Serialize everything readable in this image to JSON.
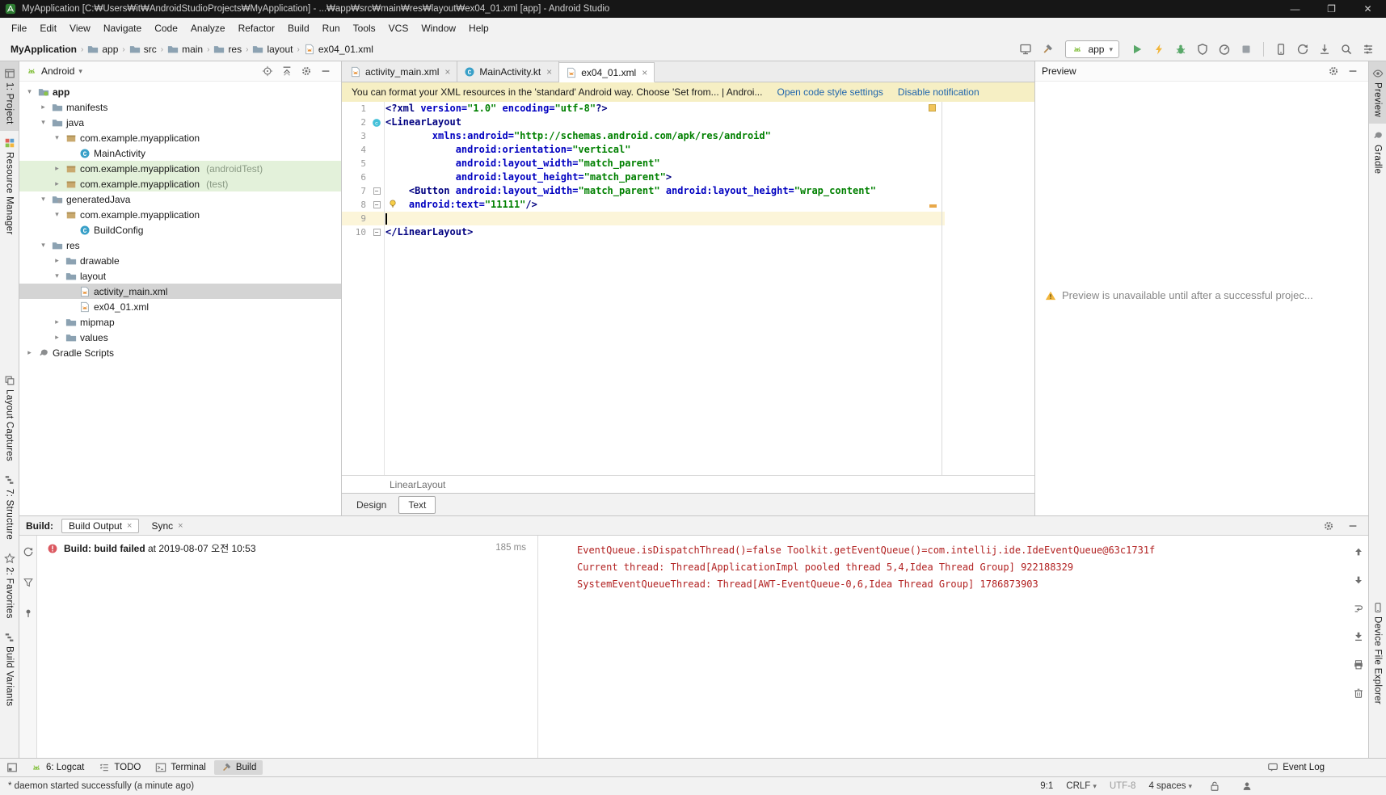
{
  "colors": {
    "accent_link": "#2166AC",
    "error_text": "#B22222",
    "banner_bg": "#F6EFC4",
    "selection_gray": "#D4D4D4",
    "test_scope_green": "#E3F1DA",
    "current_line": "#FCF5D9",
    "run_green": "#59A869",
    "tag_navy": "#000080",
    "value_green": "#008000"
  },
  "titlebar": {
    "title": "MyApplication [C:₩Users₩it₩AndroidStudioProjects₩MyApplication] - ...₩app₩src₩main₩res₩layout₩ex04_01.xml [app] - Android Studio",
    "controls": {
      "minimize": "—",
      "maximize": "❐",
      "close": "✕"
    }
  },
  "menubar": {
    "items": [
      "File",
      "Edit",
      "View",
      "Navigate",
      "Code",
      "Analyze",
      "Refactor",
      "Build",
      "Run",
      "Tools",
      "VCS",
      "Window",
      "Help"
    ]
  },
  "toolbar": {
    "breadcrumbs": [
      {
        "label": "MyApplication",
        "icon": null,
        "bold": true
      },
      {
        "label": "app",
        "icon": "folder-icon"
      },
      {
        "label": "src",
        "icon": "folder-icon"
      },
      {
        "label": "main",
        "icon": "folder-icon"
      },
      {
        "label": "res",
        "icon": "folder-icon"
      },
      {
        "label": "layout",
        "icon": "folder-icon"
      },
      {
        "label": "ex04_01.xml",
        "icon": "xml-file-icon"
      }
    ],
    "left_icons": [
      "layout-inspector-icon",
      "build-hammer-icon"
    ],
    "run_config": {
      "label": "app",
      "icon": "android-head-icon"
    },
    "right_icons": [
      "run-icon",
      "apply-changes-icon",
      "debug-icon",
      "coverage-icon",
      "profiler-icon",
      "stop-icon"
    ],
    "far_icons": [
      "avd-manager-icon",
      "gradle-sync-icon",
      "sdk-manager-icon",
      "search-icon",
      "project-structure-icon"
    ]
  },
  "project_panel": {
    "header": {
      "view": "Android",
      "icons": [
        "target-icon",
        "collapse-all-icon",
        "gear-icon",
        "hide-icon"
      ]
    },
    "tree": [
      {
        "label": "app",
        "icon": "android-module-icon",
        "chev": "down",
        "indent": 0,
        "bold": true
      },
      {
        "label": "manifests",
        "icon": "folder-icon",
        "chev": "right",
        "indent": 1
      },
      {
        "label": "java",
        "icon": "folder-icon",
        "chev": "down",
        "indent": 1
      },
      {
        "label": "com.example.myapplication",
        "icon": "package-icon",
        "chev": "down",
        "indent": 2
      },
      {
        "label": "MainActivity",
        "icon": "class-icon",
        "indent": 3
      },
      {
        "label": "com.example.myapplication",
        "suffix": "(androidTest)",
        "icon": "package-icon",
        "chev": "right",
        "indent": 2,
        "highlight": "green"
      },
      {
        "label": "com.example.myapplication",
        "suffix": "(test)",
        "icon": "package-icon",
        "chev": "right",
        "indent": 2,
        "highlight": "green"
      },
      {
        "label": "generatedJava",
        "icon": "generated-folder-icon",
        "chev": "down",
        "indent": 1
      },
      {
        "label": "com.example.myapplication",
        "icon": "package-icon",
        "chev": "down",
        "indent": 2
      },
      {
        "label": "BuildConfig",
        "icon": "class-icon",
        "indent": 3
      },
      {
        "label": "res",
        "icon": "folder-icon",
        "chev": "down",
        "indent": 1
      },
      {
        "label": "drawable",
        "icon": "folder-icon",
        "chev": "right",
        "indent": 2
      },
      {
        "label": "layout",
        "icon": "folder-icon",
        "chev": "down",
        "indent": 2
      },
      {
        "label": "activity_main.xml",
        "icon": "xml-file-icon",
        "indent": 3,
        "selected": true
      },
      {
        "label": "ex04_01.xml",
        "icon": "xml-file-icon",
        "indent": 3
      },
      {
        "label": "mipmap",
        "icon": "folder-icon",
        "chev": "right",
        "indent": 2
      },
      {
        "label": "values",
        "icon": "folder-icon",
        "chev": "right",
        "indent": 2
      },
      {
        "label": "Gradle Scripts",
        "icon": "gradle-icon",
        "chev": "right",
        "indent": 0
      }
    ]
  },
  "editor": {
    "tabs": [
      {
        "label": "activity_main.xml",
        "icon": "xml-file-icon",
        "active": false
      },
      {
        "label": "MainActivity.kt",
        "icon": "kotlin-class-icon",
        "active": false
      },
      {
        "label": "ex04_01.xml",
        "icon": "xml-file-icon",
        "active": true
      }
    ],
    "notification": {
      "text": "You can format your XML resources in the 'standard' Android way. Choose 'Set from... | Androi...",
      "link_primary": "Open code style settings",
      "link_secondary": "Disable notification"
    },
    "code": {
      "lines": [
        {
          "num": 1,
          "tokens": [
            [
              "tag",
              "<?xml"
            ],
            [
              "plain",
              " "
            ],
            [
              "attr",
              "version="
            ],
            [
              "val",
              "\"1.0\""
            ],
            [
              "plain",
              " "
            ],
            [
              "attr",
              "encoding="
            ],
            [
              "val",
              "\"utf-8\""
            ],
            [
              "tag",
              "?>"
            ]
          ]
        },
        {
          "num": 2,
          "gutter_icon": "class-circle-icon",
          "tokens": [
            [
              "tag",
              "<LinearLayout"
            ]
          ]
        },
        {
          "num": 3,
          "tokens": [
            [
              "plain",
              "        "
            ],
            [
              "attr",
              "xmlns:android="
            ],
            [
              "val",
              "\"http://schemas.android.com/apk/res/android\""
            ]
          ]
        },
        {
          "num": 4,
          "tokens": [
            [
              "plain",
              "            "
            ],
            [
              "attr",
              "android:orientation="
            ],
            [
              "val",
              "\"vertical\""
            ]
          ]
        },
        {
          "num": 5,
          "tokens": [
            [
              "plain",
              "            "
            ],
            [
              "attr",
              "android:layout_width="
            ],
            [
              "val",
              "\"match_parent\""
            ]
          ]
        },
        {
          "num": 6,
          "tokens": [
            [
              "plain",
              "            "
            ],
            [
              "attr",
              "android:layout_height="
            ],
            [
              "val",
              "\"match_parent\""
            ],
            [
              "tag",
              ">"
            ]
          ]
        },
        {
          "num": 7,
          "fold": "minus",
          "tokens": [
            [
              "plain",
              "    "
            ],
            [
              "tag",
              "<Button"
            ],
            [
              "plain",
              " "
            ],
            [
              "attr",
              "android:layout_width="
            ],
            [
              "val",
              "\"match_parent\""
            ],
            [
              "plain",
              " "
            ],
            [
              "attr",
              "android:layout_height="
            ],
            [
              "val",
              "\"wrap_content\""
            ]
          ]
        },
        {
          "num": 8,
          "fold": "minus",
          "bulb": true,
          "tokens": [
            [
              "plain",
              "    "
            ],
            [
              "attr",
              "android:text="
            ],
            [
              "val",
              "\"11111\""
            ],
            [
              "tag",
              "/>"
            ]
          ]
        },
        {
          "num": 9,
          "current": true,
          "cursor": true,
          "tokens": []
        },
        {
          "num": 10,
          "fold": "end",
          "tokens": [
            [
              "tag",
              "</LinearLayout>"
            ]
          ]
        }
      ]
    },
    "breadcrumb": "LinearLayout",
    "mode_tabs": [
      {
        "label": "Design",
        "active": false
      },
      {
        "label": "Text",
        "active": true
      }
    ]
  },
  "preview_panel": {
    "title": "Preview",
    "icons": [
      "gear-icon",
      "hide-icon"
    ],
    "message": "Preview is unavailable until after a successful projec..."
  },
  "build_panel": {
    "label": "Build:",
    "tabs": [
      {
        "label": "Build Output",
        "active": true
      },
      {
        "label": "Sync",
        "active": false
      }
    ],
    "header_icons": [
      "gear-icon",
      "hide-icon"
    ],
    "side_icons": [
      "rerun-icon",
      "filter-icon",
      "pin-icon"
    ],
    "status": {
      "bold": "Build: build failed",
      "rest": " at 2019-08-07 오전 10:53",
      "duration": "185 ms"
    },
    "console": [
      "EventQueue.isDispatchThread()=false Toolkit.getEventQueue()=com.intellij.ide.IdeEventQueue@63c1731f",
      "Current thread: Thread[ApplicationImpl pooled thread 5,4,Idea Thread Group] 922188329",
      "SystemEventQueueThread: Thread[AWT-EventQueue-0,6,Idea Thread Group] 1786873903"
    ],
    "console_icons": [
      "up-icon",
      "down-icon",
      "soft-wrap-icon",
      "scroll-end-icon",
      "print-icon",
      "clear-icon"
    ]
  },
  "tool_stripes": {
    "left_top": [
      {
        "label": "1: Project",
        "icon": "project-icon",
        "active": true
      },
      {
        "label": "Resource Manager",
        "icon": "resource-manager-icon"
      }
    ],
    "left_bottom": [
      {
        "label": "Layout Captures",
        "icon": "layout-captures-icon"
      },
      {
        "label": "7: Structure",
        "icon": "structure-icon"
      },
      {
        "label": "2: Favorites",
        "icon": "favorites-icon"
      },
      {
        "label": "Build Variants",
        "icon": "build-variants-icon"
      }
    ],
    "right_top": [
      {
        "label": "Preview",
        "icon": "preview-icon",
        "active": true
      },
      {
        "label": "Gradle",
        "icon": "gradle-icon"
      }
    ],
    "right_bottom": [
      {
        "label": "Device File Explorer",
        "icon": "device-explorer-icon"
      }
    ],
    "bottom_left": [
      {
        "label": "6: Logcat",
        "icon": "logcat-icon"
      },
      {
        "label": "TODO",
        "icon": "todo-icon"
      },
      {
        "label": "Terminal",
        "icon": "terminal-icon"
      },
      {
        "label": "Build",
        "icon": "build-hammer-icon",
        "active": true
      }
    ],
    "bottom_right": [
      {
        "label": "Event Log",
        "icon": "balloon-icon"
      }
    ]
  },
  "statusbar": {
    "message": "* daemon started successfully (a minute ago)",
    "position": "9:1",
    "line_separator": "CRLF",
    "encoding": "UTF-8",
    "indent": "4 spaces",
    "icons": [
      "lock-icon",
      "hector-icon"
    ]
  }
}
